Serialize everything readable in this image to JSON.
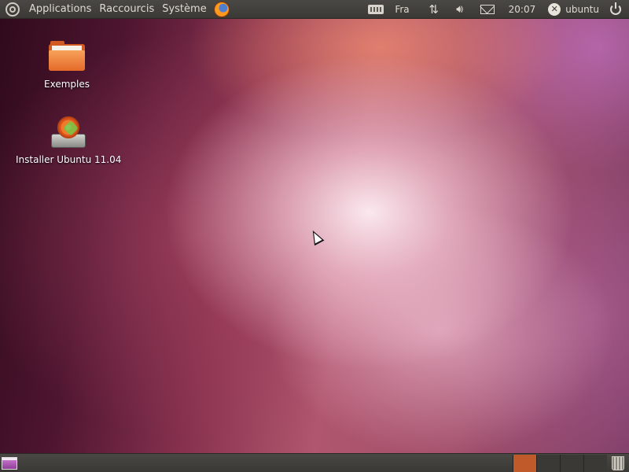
{
  "top_panel": {
    "menus": [
      "Applications",
      "Raccourcis",
      "Système"
    ],
    "keyboard_layout": "Fra",
    "clock": "20:07",
    "user": "ubuntu"
  },
  "desktop": {
    "icons": [
      {
        "label": "Exemples"
      },
      {
        "label": "Installer Ubuntu 11.04"
      }
    ]
  },
  "bottom_panel": {
    "workspaces_count": 4,
    "active_workspace": 1
  },
  "colors": {
    "panel": "#3c3b37",
    "accent": "#dd4814",
    "panel_text": "#dfdbd2"
  }
}
